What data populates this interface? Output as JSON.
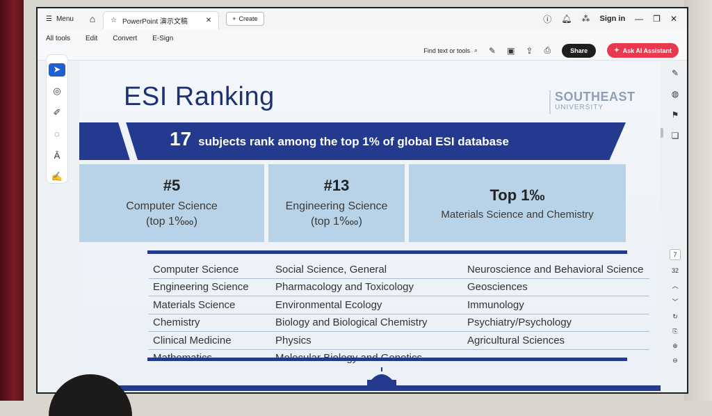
{
  "tabbar": {
    "menu_label": "Menu",
    "doc_tab_title": "PowerPoint 演示文稿",
    "create_label": "Create",
    "signin_label": "Sign in"
  },
  "toolbar": {
    "menus": [
      "All tools",
      "Edit",
      "Convert",
      "E-Sign"
    ],
    "find_label": "Find text or tools",
    "share_label": "Share",
    "ai_label": "Ask AI Assistant"
  },
  "colors": {
    "accent_blue": "#1f5fd1",
    "ai_red": "#e9394f",
    "slide_navy": "#233a8f",
    "card_blue": "#b8d3e8"
  },
  "page_nav": {
    "current_page": "7",
    "total_pages": "32"
  },
  "slide": {
    "title": "ESI Ranking",
    "logo_main": "SOUTHEAST",
    "logo_sub": "UNIVERSITY",
    "banner_number": "17",
    "banner_text": "subjects rank among the top 1% of global ESI database",
    "cards": [
      {
        "rank": "#5",
        "subject": "Computer Science",
        "note": "(top 1‱)"
      },
      {
        "rank": "#13",
        "subject": "Engineering Science",
        "note": "(top 1‱)"
      },
      {
        "rank": "Top 1‰",
        "subject": "Materials Science and Chemistry",
        "note": ""
      }
    ],
    "subjects": {
      "col1": [
        "Computer Science",
        "Engineering Science",
        "Materials Science",
        "Chemistry",
        "Clinical Medicine",
        "Mathematics"
      ],
      "col2": [
        "Social Science, General",
        "Pharmacology and Toxicology",
        "Environmental Ecology",
        "Biology and Biological Chemistry",
        "Physics",
        "Molecular Biology and Genetics"
      ],
      "col3": [
        "Neuroscience and Behavioral Science",
        "Geosciences",
        "Immunology",
        "Psychiatry/Psychology",
        "Agricultural Sciences",
        ""
      ]
    }
  }
}
